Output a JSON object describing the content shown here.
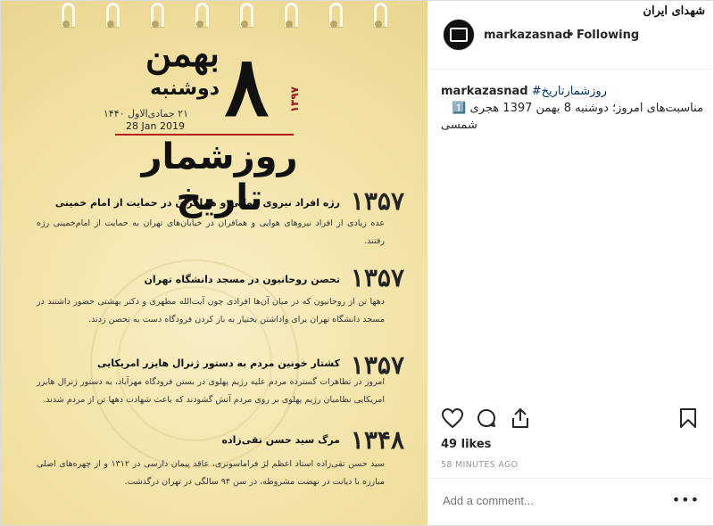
{
  "post_image": {
    "month": "بهمن",
    "weekday": "دوشنبه",
    "day_number": "۸",
    "year_shamsi": "۱۳۹۷",
    "hijri_date": "۲۱ جمادی‌الاول ۱۴۴۰",
    "gregorian_date": "28 Jan  2019",
    "title": "روزشمار تاریخ",
    "events": [
      {
        "year": "۱۳۵۷",
        "title": "رژه افراد نیروی هوایی و همافران در حمایت از امام خمینی",
        "desc": "عده زیادی از افراد نیروهای هوایی و همافران در خیابان‌های تهران به حمایت از امام‌خمینی رژه رفتند."
      },
      {
        "year": "۱۳۵۷",
        "title": "تحصن روحانیون در مسجد دانشگاه تهران",
        "desc": "دهها تن از روحانیون که در میان آن‌ها افرادی چون آیت‌الله مطهری و دکتر بهشتی حضور داشتند در مسجد دانشگاه تهران برای واداشتن بختیار به باز کردن فرودگاه دست به تحصن زدند."
      },
      {
        "year": "۱۳۵۷",
        "title": "کشتار خونین مردم به دستور ژنرال هایزر امریکایی",
        "desc": "امروز در تظاهرات گسترده مردم علیه رژیم پهلوی در بستن فرودگاه مهرآباد، به دستور ژنرال هایزر امریکایی نظامیان رژیم پهلوی بر روی مردم آتش گشودند که باعث شهادت دهها تن از مردم شدند."
      },
      {
        "year": "۱۳۴۸",
        "title": "مرگ سید حسن تقی‌زاده",
        "desc": "سید حسن تقی‌زاده استاد اعظم لژ فراماسونری، عاقد پیمان دارسی در ۱۳۱۲ و از چهره‌های اصلی مبارزه با دیانت در نهضت مشروطه، در سن ۹۴ سالگی در تهران درگذشت."
      }
    ]
  },
  "header": {
    "username": "markazasnad",
    "separator": "•",
    "follow_label": "Following",
    "logo_text": "شهدای ایران"
  },
  "caption": {
    "username": "markazasnad",
    "hashtag": "#روزشمارتاریخ",
    "text": "مناسبت‌های امروز؛ دوشنبه 8 بهمن 1397 هجری 1️⃣",
    "text2": "شمسی"
  },
  "actions": {
    "like_icon": "heart-icon",
    "comment_icon": "comment-icon",
    "share_icon": "share-icon",
    "save_icon": "bookmark-icon"
  },
  "likes": "49 likes",
  "timestamp": "58 MINUTES AGO",
  "comment": {
    "placeholder": "Add a comment...",
    "more_label": "•••"
  }
}
